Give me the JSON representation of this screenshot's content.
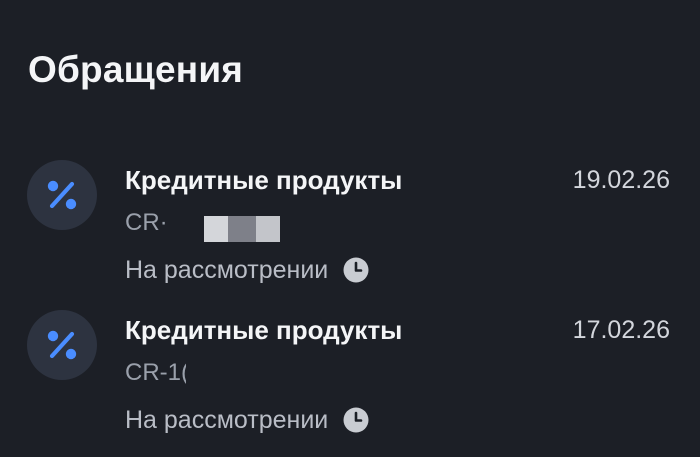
{
  "header": {
    "title": "Обращения"
  },
  "requests": [
    {
      "category": "Кредитные продукты",
      "date": "19.02.26",
      "number": "CR·",
      "status": "На рассмотрении",
      "icon": "percent-icon",
      "status_icon": "clock-icon"
    },
    {
      "category": "Кредитные продукты",
      "date": "17.02.26",
      "number": "CR-1(",
      "status": "На рассмотрении",
      "icon": "percent-icon",
      "status_icon": "clock-icon"
    }
  ],
  "colors": {
    "background": "#1c1f26",
    "icon_circle": "#2d3340",
    "accent_blue": "#4a8dff",
    "title_text": "#f4f5f7",
    "secondary_text": "#9aa0ab"
  }
}
